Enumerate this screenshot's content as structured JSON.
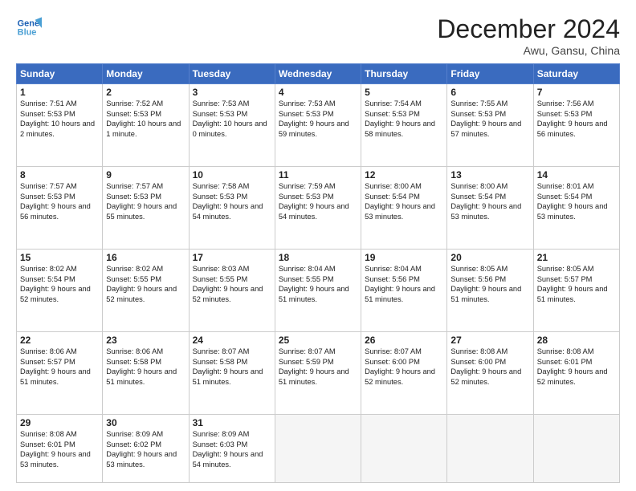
{
  "header": {
    "logo_line1": "General",
    "logo_line2": "Blue",
    "month": "December 2024",
    "location": "Awu, Gansu, China"
  },
  "weekdays": [
    "Sunday",
    "Monday",
    "Tuesday",
    "Wednesday",
    "Thursday",
    "Friday",
    "Saturday"
  ],
  "weeks": [
    [
      {
        "day": "1",
        "sunrise": "Sunrise: 7:51 AM",
        "sunset": "Sunset: 5:53 PM",
        "daylight": "Daylight: 10 hours and 2 minutes."
      },
      {
        "day": "2",
        "sunrise": "Sunrise: 7:52 AM",
        "sunset": "Sunset: 5:53 PM",
        "daylight": "Daylight: 10 hours and 1 minute."
      },
      {
        "day": "3",
        "sunrise": "Sunrise: 7:53 AM",
        "sunset": "Sunset: 5:53 PM",
        "daylight": "Daylight: 10 hours and 0 minutes."
      },
      {
        "day": "4",
        "sunrise": "Sunrise: 7:53 AM",
        "sunset": "Sunset: 5:53 PM",
        "daylight": "Daylight: 9 hours and 59 minutes."
      },
      {
        "day": "5",
        "sunrise": "Sunrise: 7:54 AM",
        "sunset": "Sunset: 5:53 PM",
        "daylight": "Daylight: 9 hours and 58 minutes."
      },
      {
        "day": "6",
        "sunrise": "Sunrise: 7:55 AM",
        "sunset": "Sunset: 5:53 PM",
        "daylight": "Daylight: 9 hours and 57 minutes."
      },
      {
        "day": "7",
        "sunrise": "Sunrise: 7:56 AM",
        "sunset": "Sunset: 5:53 PM",
        "daylight": "Daylight: 9 hours and 56 minutes."
      }
    ],
    [
      {
        "day": "8",
        "sunrise": "Sunrise: 7:57 AM",
        "sunset": "Sunset: 5:53 PM",
        "daylight": "Daylight: 9 hours and 56 minutes."
      },
      {
        "day": "9",
        "sunrise": "Sunrise: 7:57 AM",
        "sunset": "Sunset: 5:53 PM",
        "daylight": "Daylight: 9 hours and 55 minutes."
      },
      {
        "day": "10",
        "sunrise": "Sunrise: 7:58 AM",
        "sunset": "Sunset: 5:53 PM",
        "daylight": "Daylight: 9 hours and 54 minutes."
      },
      {
        "day": "11",
        "sunrise": "Sunrise: 7:59 AM",
        "sunset": "Sunset: 5:53 PM",
        "daylight": "Daylight: 9 hours and 54 minutes."
      },
      {
        "day": "12",
        "sunrise": "Sunrise: 8:00 AM",
        "sunset": "Sunset: 5:54 PM",
        "daylight": "Daylight: 9 hours and 53 minutes."
      },
      {
        "day": "13",
        "sunrise": "Sunrise: 8:00 AM",
        "sunset": "Sunset: 5:54 PM",
        "daylight": "Daylight: 9 hours and 53 minutes."
      },
      {
        "day": "14",
        "sunrise": "Sunrise: 8:01 AM",
        "sunset": "Sunset: 5:54 PM",
        "daylight": "Daylight: 9 hours and 53 minutes."
      }
    ],
    [
      {
        "day": "15",
        "sunrise": "Sunrise: 8:02 AM",
        "sunset": "Sunset: 5:54 PM",
        "daylight": "Daylight: 9 hours and 52 minutes."
      },
      {
        "day": "16",
        "sunrise": "Sunrise: 8:02 AM",
        "sunset": "Sunset: 5:55 PM",
        "daylight": "Daylight: 9 hours and 52 minutes."
      },
      {
        "day": "17",
        "sunrise": "Sunrise: 8:03 AM",
        "sunset": "Sunset: 5:55 PM",
        "daylight": "Daylight: 9 hours and 52 minutes."
      },
      {
        "day": "18",
        "sunrise": "Sunrise: 8:04 AM",
        "sunset": "Sunset: 5:55 PM",
        "daylight": "Daylight: 9 hours and 51 minutes."
      },
      {
        "day": "19",
        "sunrise": "Sunrise: 8:04 AM",
        "sunset": "Sunset: 5:56 PM",
        "daylight": "Daylight: 9 hours and 51 minutes."
      },
      {
        "day": "20",
        "sunrise": "Sunrise: 8:05 AM",
        "sunset": "Sunset: 5:56 PM",
        "daylight": "Daylight: 9 hours and 51 minutes."
      },
      {
        "day": "21",
        "sunrise": "Sunrise: 8:05 AM",
        "sunset": "Sunset: 5:57 PM",
        "daylight": "Daylight: 9 hours and 51 minutes."
      }
    ],
    [
      {
        "day": "22",
        "sunrise": "Sunrise: 8:06 AM",
        "sunset": "Sunset: 5:57 PM",
        "daylight": "Daylight: 9 hours and 51 minutes."
      },
      {
        "day": "23",
        "sunrise": "Sunrise: 8:06 AM",
        "sunset": "Sunset: 5:58 PM",
        "daylight": "Daylight: 9 hours and 51 minutes."
      },
      {
        "day": "24",
        "sunrise": "Sunrise: 8:07 AM",
        "sunset": "Sunset: 5:58 PM",
        "daylight": "Daylight: 9 hours and 51 minutes."
      },
      {
        "day": "25",
        "sunrise": "Sunrise: 8:07 AM",
        "sunset": "Sunset: 5:59 PM",
        "daylight": "Daylight: 9 hours and 51 minutes."
      },
      {
        "day": "26",
        "sunrise": "Sunrise: 8:07 AM",
        "sunset": "Sunset: 6:00 PM",
        "daylight": "Daylight: 9 hours and 52 minutes."
      },
      {
        "day": "27",
        "sunrise": "Sunrise: 8:08 AM",
        "sunset": "Sunset: 6:00 PM",
        "daylight": "Daylight: 9 hours and 52 minutes."
      },
      {
        "day": "28",
        "sunrise": "Sunrise: 8:08 AM",
        "sunset": "Sunset: 6:01 PM",
        "daylight": "Daylight: 9 hours and 52 minutes."
      }
    ],
    [
      {
        "day": "29",
        "sunrise": "Sunrise: 8:08 AM",
        "sunset": "Sunset: 6:01 PM",
        "daylight": "Daylight: 9 hours and 53 minutes."
      },
      {
        "day": "30",
        "sunrise": "Sunrise: 8:09 AM",
        "sunset": "Sunset: 6:02 PM",
        "daylight": "Daylight: 9 hours and 53 minutes."
      },
      {
        "day": "31",
        "sunrise": "Sunrise: 8:09 AM",
        "sunset": "Sunset: 6:03 PM",
        "daylight": "Daylight: 9 hours and 54 minutes."
      },
      null,
      null,
      null,
      null
    ]
  ]
}
